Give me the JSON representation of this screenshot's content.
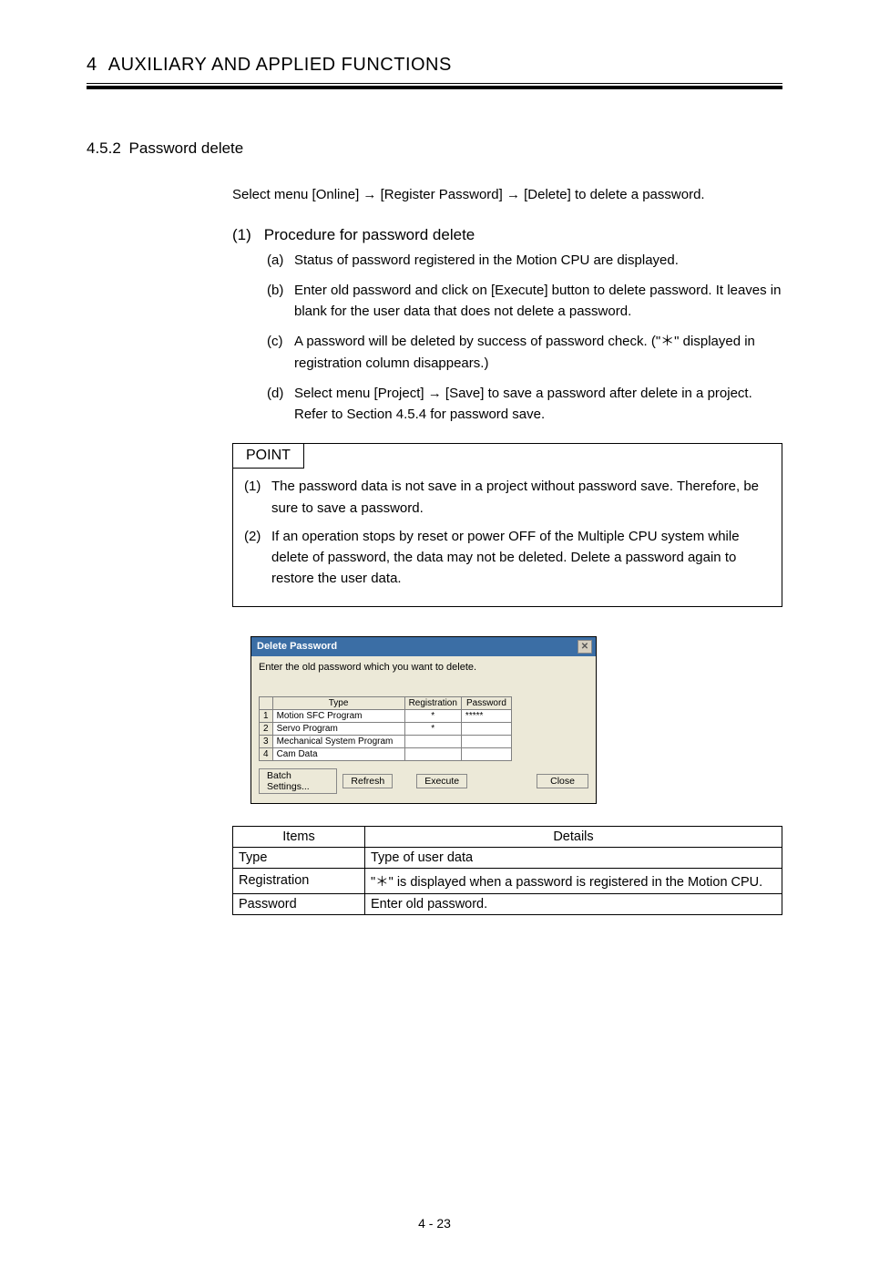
{
  "header": {
    "chapter_num": "4",
    "chapter_title": "AUXILIARY AND APPLIED FUNCTIONS"
  },
  "section": {
    "number": "4.5.2",
    "title": "Password delete"
  },
  "intro": "Select menu [Online] → [Register Password] → [Delete] to delete a password.",
  "procedure": {
    "num": "(1)",
    "title": "Procedure for password delete",
    "items": [
      {
        "lbl": "(a)",
        "txt": "Status of password registered in the Motion CPU are displayed."
      },
      {
        "lbl": "(b)",
        "txt": "Enter old password and click on [Execute] button to delete password. It leaves in blank for the user data that does not delete a password."
      },
      {
        "lbl": "(c)",
        "txt": "A password will be deleted by success of password check. (\"＊\" displayed in registration column disappears.)"
      },
      {
        "lbl": "(d)",
        "txt": "Select menu [Project] → [Save] to save a password after delete in a project. Refer to Section 4.5.4 for password save."
      }
    ]
  },
  "point": {
    "label": "POINT",
    "items": [
      {
        "lbl": "(1)",
        "txt": "The password data is not save in a project without password save. Therefore, be sure to save a password."
      },
      {
        "lbl": "(2)",
        "txt": "If an operation stops by reset or power OFF of the Multiple CPU system while delete of password, the data may not be deleted. Delete a password again to restore the user data."
      }
    ]
  },
  "dialog": {
    "title": "Delete Password",
    "instruction": "Enter the old password which you want to delete.",
    "columns": {
      "blank": "",
      "type": "Type",
      "registration": "Registration",
      "password": "Password"
    },
    "rows": [
      {
        "n": "1",
        "type": "Motion SFC Program",
        "reg": "*",
        "pwd": "*****"
      },
      {
        "n": "2",
        "type": "Servo Program",
        "reg": "*",
        "pwd": ""
      },
      {
        "n": "3",
        "type": "Mechanical System Program",
        "reg": "",
        "pwd": ""
      },
      {
        "n": "4",
        "type": "Cam Data",
        "reg": "",
        "pwd": ""
      }
    ],
    "buttons": {
      "batch": "Batch Settings...",
      "refresh": "Refresh",
      "execute": "Execute",
      "close": "Close"
    }
  },
  "details": {
    "header": {
      "items": "Items",
      "details": "Details"
    },
    "rows": [
      {
        "item": "Type",
        "detail": "Type of user data"
      },
      {
        "item": "Registration",
        "detail": "\"＊\" is displayed when a password is registered in the Motion CPU."
      },
      {
        "item": "Password",
        "detail": "Enter old password."
      }
    ]
  },
  "footer": "4 - 23"
}
